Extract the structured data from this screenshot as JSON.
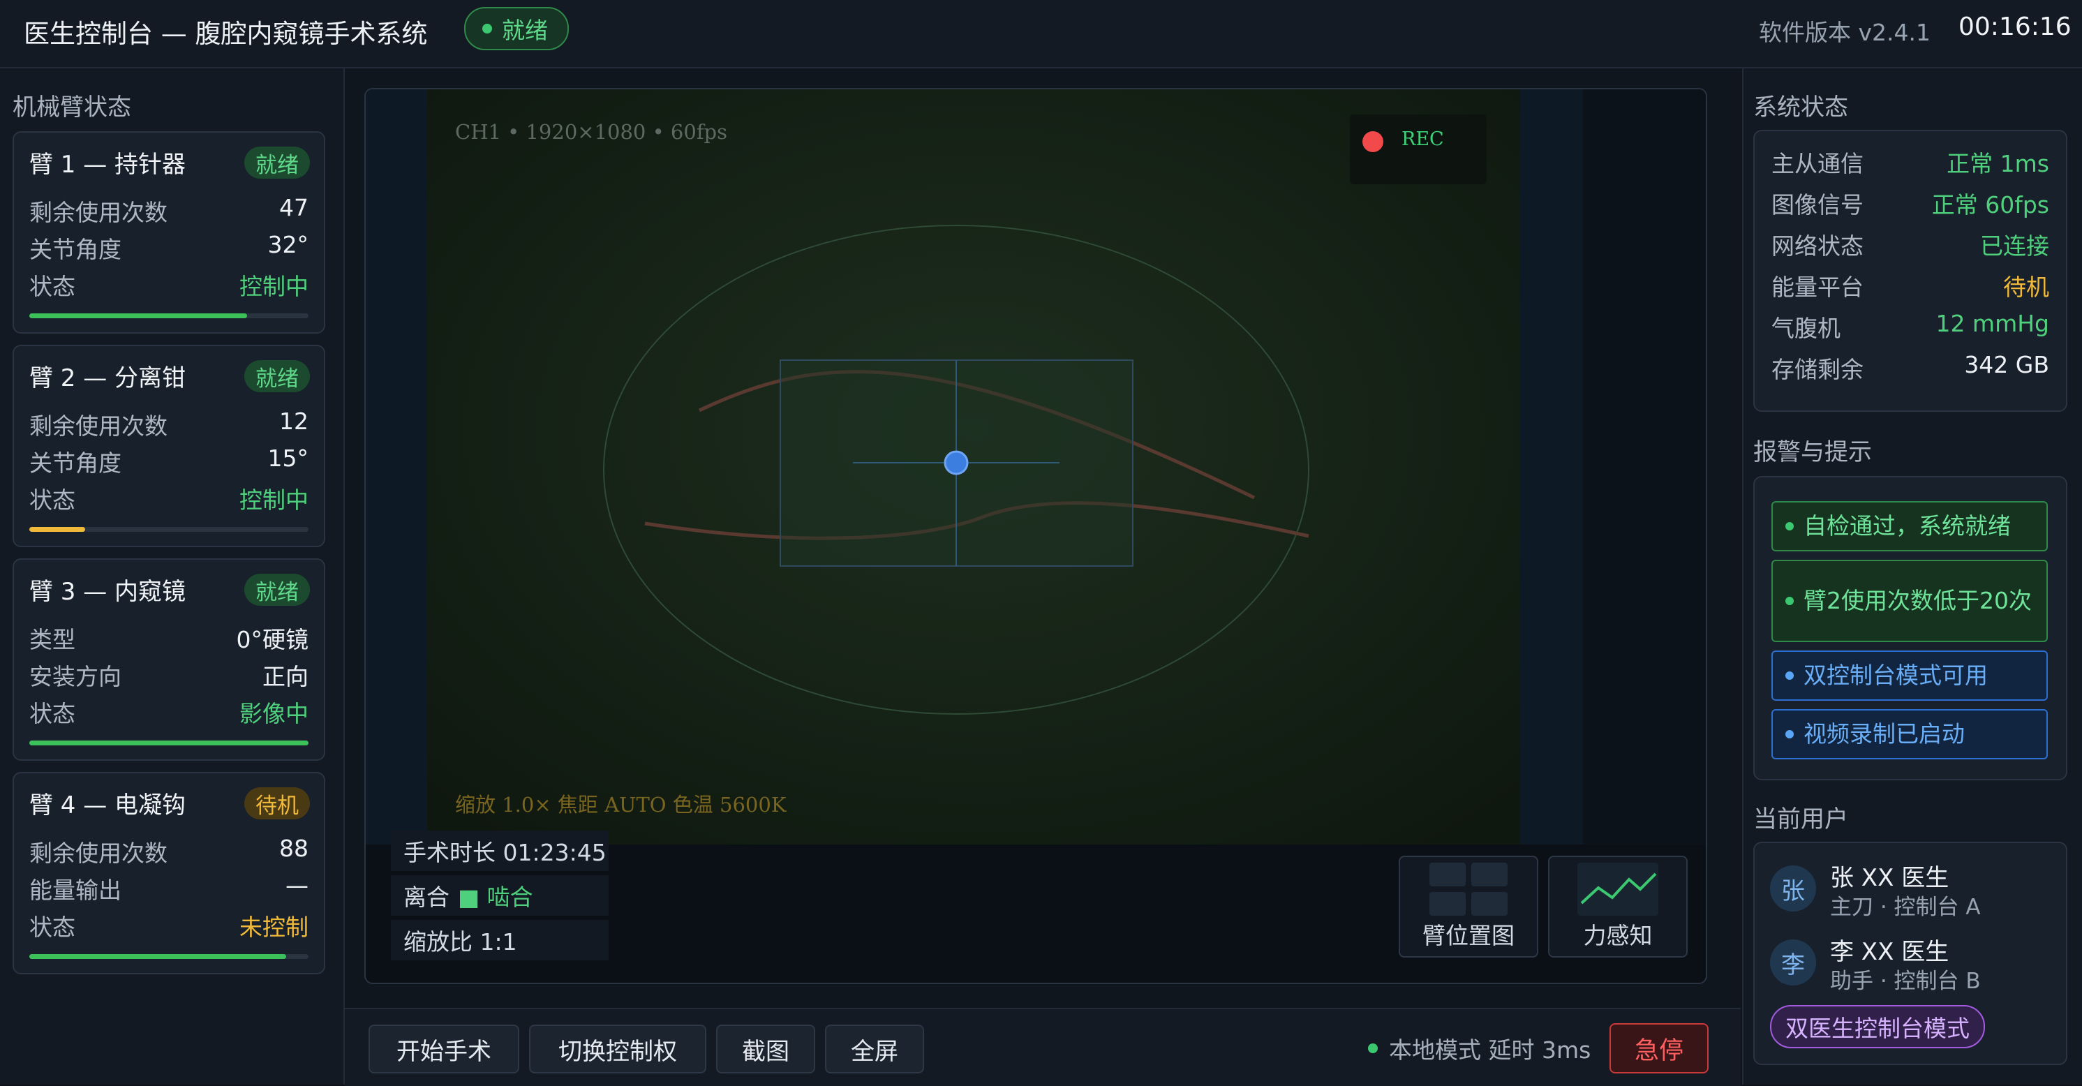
{
  "header": {
    "title": "医生控制台 — 腹腔内窥镜手术系统",
    "status": "就绪",
    "version": "软件版本 v2.4.1",
    "time": "00:16:16"
  },
  "arms_panel": {
    "title": "机械臂状态",
    "arms": [
      {
        "name": "臂 1 — 持针器",
        "badge": "就绪",
        "rows": [
          [
            "剩余使用次数",
            "47"
          ],
          [
            "关节角度",
            "32°"
          ],
          [
            "状态",
            "控制中"
          ]
        ],
        "progress": 0.78
      },
      {
        "name": "臂 2 — 分离钳",
        "badge": "就绪",
        "rows": [
          [
            "剩余使用次数",
            "12"
          ],
          [
            "关节角度",
            "15°"
          ],
          [
            "状态",
            "控制中"
          ]
        ],
        "progress": 0.2
      },
      {
        "name": "臂 3 — 内窥镜",
        "badge": "就绪",
        "rows": [
          [
            "类型",
            "0°硬镜"
          ],
          [
            "安装方向",
            "正向"
          ],
          [
            "状态",
            "影像中"
          ]
        ],
        "progress": 1.0
      },
      {
        "name": "臂 4 — 电凝钩",
        "badge": "待机",
        "rows": [
          [
            "剩余使用次数",
            "88"
          ],
          [
            "能量输出",
            "—"
          ],
          [
            "状态",
            "未控制"
          ]
        ],
        "progress": 0.92
      }
    ]
  },
  "video": {
    "channel_info": "CH1  •  1920×1080  •  60fps",
    "rec": "REC",
    "camera_info": "缩放 1.0×  焦距 AUTO  色温 5600K",
    "duration": "手术时长 01:23:45",
    "grip_label": "离合",
    "grip_state": "■ 啮合",
    "scale": "缩放比 1:1",
    "arm_map_label": "臂位置图",
    "force_label": "力感知"
  },
  "toolbar": {
    "start": "开始手术",
    "switch": "切换控制权",
    "screenshot": "截图",
    "fullscreen": "全屏",
    "mode": "本地模式 延时 3ms",
    "estop": "急停"
  },
  "system": {
    "title": "系统状态",
    "rows": [
      {
        "label": "主从通信",
        "value": "正常 1ms",
        "color": "#4fd07c"
      },
      {
        "label": "图像信号",
        "value": "正常 60fps",
        "color": "#4fd07c"
      },
      {
        "label": "网络状态",
        "value": "已连接",
        "color": "#4fd07c"
      },
      {
        "label": "能量平台",
        "value": "待机",
        "color": "#f0b93a"
      },
      {
        "label": "气腹机",
        "value": "12 mmHg",
        "color": "#4fd07c"
      },
      {
        "label": "存储剩余",
        "value": "342 GB",
        "color": "#eef2f6"
      }
    ]
  },
  "alerts": {
    "title": "报警与提示",
    "items": [
      {
        "text": "自检通过，系统就绪",
        "kind": "green"
      },
      {
        "text": "臂2使用次数低于20次",
        "kind": "green"
      },
      {
        "text": "双控制台模式可用",
        "kind": "blue"
      },
      {
        "text": "视频录制已启动",
        "kind": "blue"
      }
    ]
  },
  "users": {
    "title": "当前用户",
    "list": [
      {
        "avatar": "张",
        "name": "张 XX 医生",
        "role": "主刀 · 控制台 A"
      },
      {
        "avatar": "李",
        "name": "李 XX 医生",
        "role": "助手 · 控制台 B"
      }
    ],
    "mode_badge": "双医生控制台模式"
  }
}
